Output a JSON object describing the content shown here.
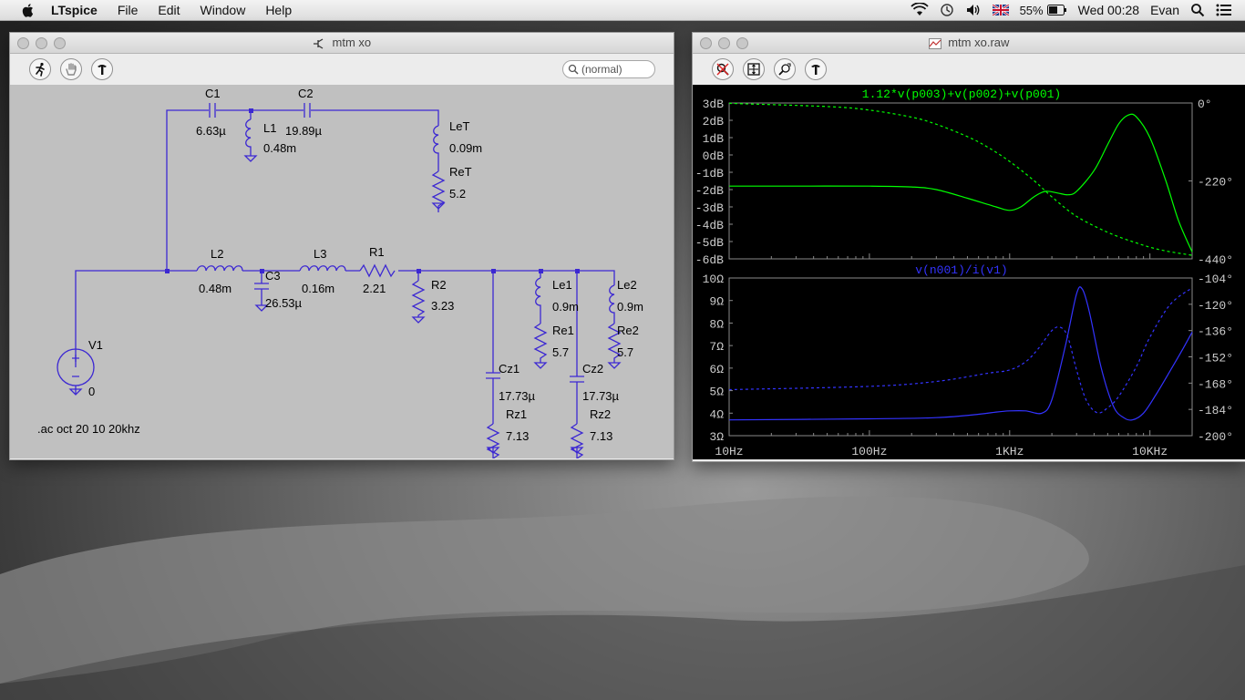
{
  "menubar": {
    "app_name": "LTspice",
    "menus": [
      "File",
      "Edit",
      "Window",
      "Help"
    ],
    "battery": "55%",
    "clock": "Wed 00:28",
    "user": "Evan"
  },
  "schematic_window": {
    "title": "mtm xo",
    "search_placeholder": "(normal)",
    "directive": ".ac oct 20 10 20khz",
    "components": {
      "C1": {
        "name": "C1",
        "value": "6.63µ"
      },
      "C2": {
        "name": "C2",
        "value": "19.89µ"
      },
      "L1": {
        "name": "L1",
        "value": "0.48m"
      },
      "LeT": {
        "name": "LeT",
        "value": "0.09m"
      },
      "ReT": {
        "name": "ReT",
        "value": "5.2"
      },
      "L2": {
        "name": "L2",
        "value": "0.48m"
      },
      "C3": {
        "name": "C3",
        "value": "26.53µ"
      },
      "L3": {
        "name": "L3",
        "value": "0.16m"
      },
      "R1": {
        "name": "R1",
        "value": "2.21"
      },
      "R2": {
        "name": "R2",
        "value": "3.23"
      },
      "Le1": {
        "name": "Le1",
        "value": "0.9m"
      },
      "Re1": {
        "name": "Re1",
        "value": "5.7"
      },
      "Le2": {
        "name": "Le2",
        "value": "0.9m"
      },
      "Re2": {
        "name": "Re2",
        "value": "5.7"
      },
      "Cz1": {
        "name": "Cz1",
        "value": "17.73µ"
      },
      "Rz1": {
        "name": "Rz1",
        "value": "7.13"
      },
      "Cz2": {
        "name": "Cz2",
        "value": "17.73µ"
      },
      "Rz2": {
        "name": "Rz2",
        "value": "7.13"
      },
      "V1": {
        "name": "V1",
        "value": "0"
      }
    },
    "wire_color": "#3c28d2"
  },
  "plot_window": {
    "title": "mtm xo.raw"
  },
  "chart_data": [
    {
      "type": "line",
      "title": "1.12*v(p003)+v(p002)+v(p001)",
      "x_scale": "log",
      "x_ticks": [
        "10Hz",
        "100Hz",
        "1KHz",
        "10KHz"
      ],
      "x_range_hz": [
        10,
        20000
      ],
      "y_ticks": [
        "3dB",
        "2dB",
        "1dB",
        "0dB",
        "-1dB",
        "-2dB",
        "-3dB",
        "-4dB",
        "-5dB",
        "-6dB"
      ],
      "y_range": [
        -6,
        3
      ],
      "y2_ticks": [
        "0°",
        "-220°",
        "-440°"
      ],
      "y2_range": [
        -440,
        0
      ],
      "color": "#00ff00",
      "series": [
        {
          "style": "solid",
          "x": [
            10,
            30,
            100,
            200,
            300,
            500,
            800,
            1000,
            1200,
            1500,
            1800,
            2200,
            2600,
            3000,
            4000,
            5000,
            6000,
            7000,
            8000,
            10000,
            13000,
            16000,
            20000
          ],
          "y": [
            -1.8,
            -1.8,
            -1.8,
            -1.85,
            -2.0,
            -2.5,
            -3.0,
            -3.2,
            -3.0,
            -2.4,
            -2.1,
            -2.2,
            -2.3,
            -2.1,
            -0.9,
            0.6,
            1.8,
            2.3,
            2.2,
            1.0,
            -1.5,
            -3.8,
            -5.6
          ]
        },
        {
          "style": "dashed",
          "x": [
            10,
            50,
            100,
            200,
            300,
            500,
            700,
            1000,
            1500,
            2000,
            3000,
            5000,
            8000,
            12000,
            20000
          ],
          "y2": [
            -1,
            -10,
            -20,
            -40,
            -60,
            -95,
            -125,
            -165,
            -220,
            -265,
            -320,
            -365,
            -395,
            -415,
            -430
          ]
        }
      ]
    },
    {
      "type": "line",
      "title": "v(n001)/i(v1)",
      "x_scale": "log",
      "x_ticks": [
        "10Hz",
        "100Hz",
        "1KHz",
        "10KHz"
      ],
      "x_range_hz": [
        10,
        20000
      ],
      "y_ticks": [
        "10Ω",
        "9Ω",
        "8Ω",
        "7Ω",
        "6Ω",
        "5Ω",
        "4Ω",
        "3Ω"
      ],
      "y_range": [
        3,
        10
      ],
      "y2_ticks": [
        "-104°",
        "-120°",
        "-136°",
        "-152°",
        "-168°",
        "-184°",
        "-200°"
      ],
      "y2_range": [
        -200,
        -104
      ],
      "color": "#3333ff",
      "series": [
        {
          "style": "solid",
          "x": [
            10,
            100,
            300,
            600,
            800,
            1000,
            1300,
            1700,
            2000,
            2500,
            3000,
            3300,
            3700,
            4500,
            5500,
            6500,
            7500,
            9000,
            11000,
            14000,
            17000,
            20000
          ],
          "y": [
            3.7,
            3.75,
            3.8,
            3.95,
            4.05,
            4.1,
            4.1,
            4.0,
            4.6,
            7.0,
            9.3,
            9.5,
            8.5,
            6.0,
            4.3,
            3.8,
            3.7,
            4.0,
            4.8,
            5.9,
            6.8,
            7.6
          ]
        },
        {
          "style": "dashed",
          "x": [
            10,
            100,
            300,
            700,
            1000,
            1300,
            1600,
            2000,
            2300,
            2600,
            3000,
            3500,
            4200,
            5000,
            6000,
            8000,
            10000,
            14000,
            20000
          ],
          "y2": [
            -172,
            -170,
            -167,
            -162,
            -160,
            -155,
            -147,
            -136,
            -134,
            -140,
            -160,
            -178,
            -186,
            -183,
            -176,
            -158,
            -140,
            -120,
            -110
          ]
        }
      ]
    }
  ]
}
